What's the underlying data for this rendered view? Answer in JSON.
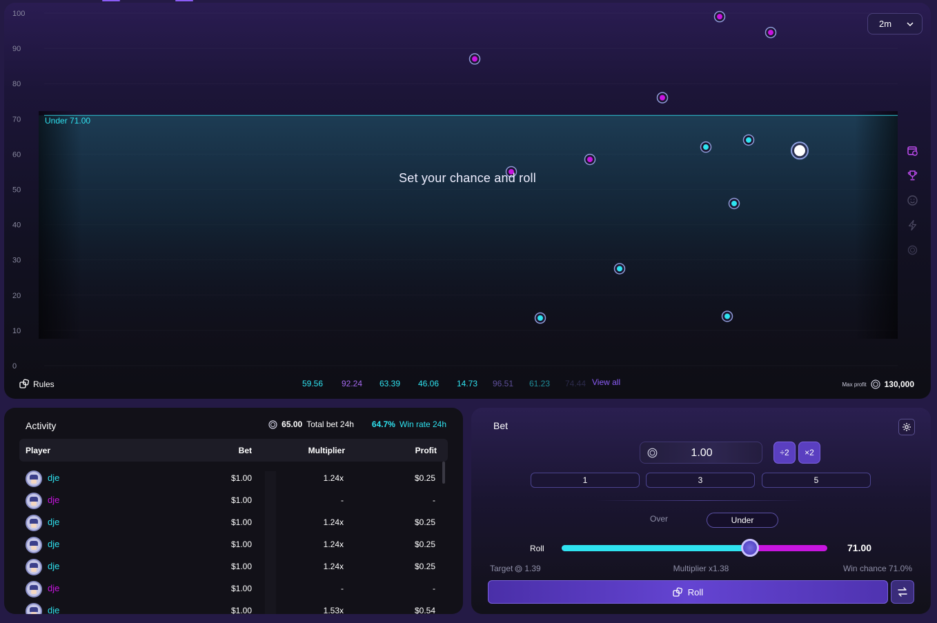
{
  "chart_data": {
    "type": "scatter",
    "y_ticks": [
      "100",
      "90",
      "80",
      "70",
      "60",
      "50",
      "40",
      "30",
      "20",
      "10",
      "0"
    ],
    "ylim": [
      0,
      100
    ],
    "threshold": 71,
    "threshold_label": "Under 71.00",
    "center_text": "Set your chance and roll",
    "points": [
      {
        "x": 1,
        "y": 87,
        "win": false
      },
      {
        "x": 2,
        "y": 55,
        "win": false
      },
      {
        "x": 3,
        "y": 13.5,
        "win": true
      },
      {
        "x": 4,
        "y": 58.5,
        "win": false
      },
      {
        "x": 5,
        "y": 27.5,
        "win": true
      },
      {
        "x": 6,
        "y": 76,
        "win": false
      },
      {
        "x": 7,
        "y": 62,
        "win": true
      },
      {
        "x": 8,
        "y": 99,
        "win": false
      },
      {
        "x": 9,
        "y": 14,
        "win": true
      },
      {
        "x": 10,
        "y": 46,
        "win": true
      },
      {
        "x": 11,
        "y": 64,
        "win": true
      },
      {
        "x": 12,
        "y": 94.5,
        "win": false
      },
      {
        "x": 13,
        "y": 61,
        "win": true,
        "current": true
      }
    ],
    "history": [
      {
        "value": "59.56",
        "color": "#2fe3f0"
      },
      {
        "value": "92.24",
        "color": "#a569f0"
      },
      {
        "value": "63.39",
        "color": "#2fe3f0"
      },
      {
        "value": "46.06",
        "color": "#2fe3f0"
      },
      {
        "value": "14.73",
        "color": "#2fe3f0"
      },
      {
        "value": "96.51",
        "color": "#5e4f9a"
      },
      {
        "value": "61.23",
        "color": "#1f8e9a"
      },
      {
        "value": "74.44",
        "color": "#2b2a4a"
      }
    ]
  },
  "colors": {
    "accent_cyan": "#2fe3f0",
    "accent_magenta": "#c815e0",
    "accent_purple": "#6444d2"
  },
  "chart_panel": {
    "time_range": "2m",
    "rules_label": "Rules",
    "view_all": "View all",
    "max_profit_label": "Max profit",
    "max_profit_value": "130,000",
    "side_icons": [
      "calendar-clock-icon",
      "trophy-icon",
      "smile-icon",
      "lightning-icon",
      "coin-icon"
    ]
  },
  "activity": {
    "title": "Activity",
    "total_bet_value": "65.00",
    "total_bet_label": "Total bet 24h",
    "win_rate_value": "64.7%",
    "win_rate_label": "Win rate 24h",
    "columns": {
      "player": "Player",
      "bet": "Bet",
      "multiplier": "Multiplier",
      "profit": "Profit"
    },
    "rows": [
      {
        "player": "dje",
        "win": true,
        "bet": "$1.00",
        "multiplier": "1.24x",
        "profit": "$0.25"
      },
      {
        "player": "dje",
        "win": false,
        "bet": "$1.00",
        "multiplier": "-",
        "profit": "-"
      },
      {
        "player": "dje",
        "win": true,
        "bet": "$1.00",
        "multiplier": "1.24x",
        "profit": "$0.25"
      },
      {
        "player": "dje",
        "win": true,
        "bet": "$1.00",
        "multiplier": "1.24x",
        "profit": "$0.25"
      },
      {
        "player": "dje",
        "win": true,
        "bet": "$1.00",
        "multiplier": "1.24x",
        "profit": "$0.25"
      },
      {
        "player": "dje",
        "win": false,
        "bet": "$1.00",
        "multiplier": "-",
        "profit": "-"
      },
      {
        "player": "dje",
        "win": true,
        "bet": "$1.00",
        "multiplier": "1.53x",
        "profit": "$0.54"
      }
    ]
  },
  "bet": {
    "title": "Bet",
    "amount": "1.00",
    "half_label": "÷2",
    "double_label": "×2",
    "quick": [
      "1",
      "3",
      "5"
    ],
    "over_label": "Over",
    "under_label": "Under",
    "roll_label": "Roll",
    "roll_value": "71.00",
    "roll_fraction": 0.71,
    "target_label": "Target",
    "target_value": "1.39",
    "multiplier_text": "Multiplier x1.38",
    "win_chance_text": "Win chance 71.0%",
    "roll_button": "Roll"
  }
}
